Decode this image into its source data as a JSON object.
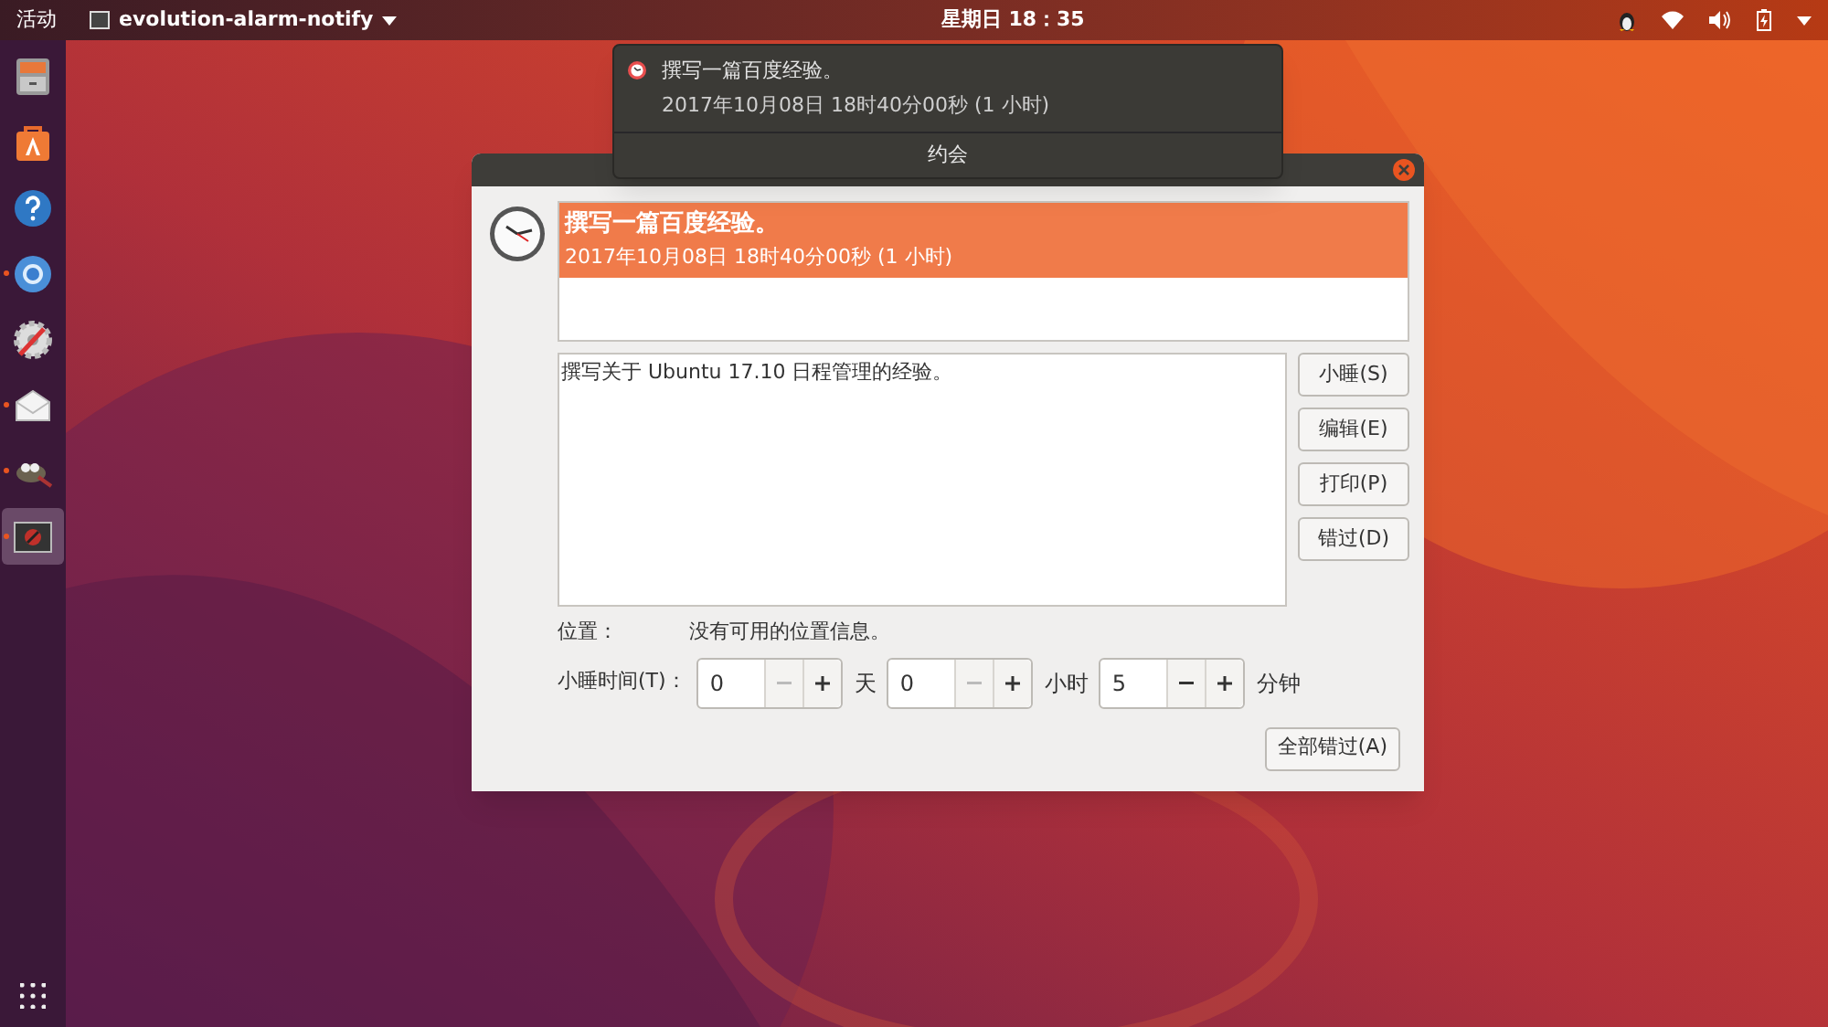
{
  "top_bar": {
    "activities": "活动",
    "app_menu": "evolution-alarm-notify",
    "clock": "星期日 18：35"
  },
  "dock": {
    "items": [
      {
        "kind": "files",
        "running": false,
        "selected": false
      },
      {
        "kind": "software",
        "running": false,
        "selected": false
      },
      {
        "kind": "help",
        "running": false,
        "selected": false
      },
      {
        "kind": "browser",
        "running": true,
        "selected": false
      },
      {
        "kind": "settings",
        "running": false,
        "selected": false
      },
      {
        "kind": "mail",
        "running": true,
        "selected": false
      },
      {
        "kind": "gimp",
        "running": true,
        "selected": false
      },
      {
        "kind": "monitor",
        "running": true,
        "selected": true
      }
    ]
  },
  "notification": {
    "title": "撰写一篇百度经验。",
    "time": "2017年10月08日 18时40分00秒 (1 小时)",
    "action": "约会"
  },
  "dialog": {
    "alarms": [
      {
        "title": "撰写一篇百度经验。",
        "time": "2017年10月08日 18时40分00秒 (1 小时)",
        "selected": true
      }
    ],
    "description": "撰写关于 Ubuntu 17.10 日程管理的经验。",
    "buttons": [
      "小睡(S)",
      "编辑(E)",
      "打印(P)",
      "错过(D)"
    ],
    "location_label": "位置：",
    "location_value": "没有可用的位置信息。",
    "snooze_label": "小睡时间(T)：",
    "spinners": [
      {
        "value": "0",
        "unit": "天",
        "minus_disabled": true
      },
      {
        "value": "0",
        "unit": "小时",
        "minus_disabled": true
      },
      {
        "value": "5",
        "unit": "分钟",
        "minus_disabled": false
      }
    ],
    "dismiss_all": "全部错过(A)"
  }
}
